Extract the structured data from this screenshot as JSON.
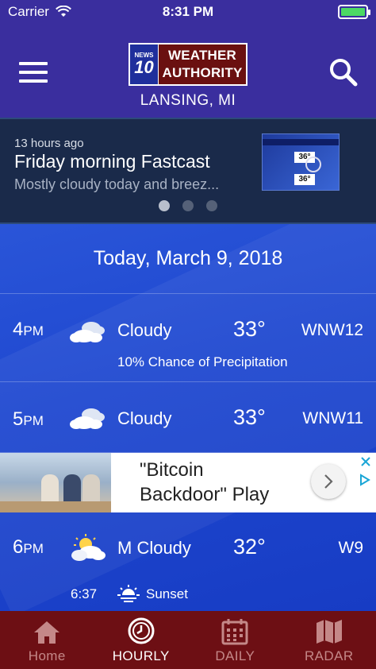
{
  "status_bar": {
    "carrier": "Carrier",
    "time": "8:31 PM"
  },
  "header": {
    "logo_badge_top": "NEWS",
    "logo_badge_number": "10",
    "logo_line1": "WEATHER",
    "logo_line2": "AUTHORITY",
    "location": "LANSING, MI"
  },
  "video": {
    "age": "13 hours ago",
    "title": "Friday morning Fastcast",
    "description": "Mostly cloudy today and breez...",
    "thumb_temp1": "36°",
    "thumb_temp2": "36°"
  },
  "forecast": {
    "date": "Today, March 9, 2018",
    "hours": [
      {
        "hour": "4",
        "ampm": "PM",
        "icon": "cloudy-icon",
        "condition": "Cloudy",
        "temp": "33°",
        "wind": "WNW12",
        "precip": "10% Chance of Precipitation"
      },
      {
        "hour": "5",
        "ampm": "PM",
        "icon": "cloudy-icon",
        "condition": "Cloudy",
        "temp": "33°",
        "wind": "WNW11"
      },
      {
        "hour": "6",
        "ampm": "PM",
        "icon": "mostly-cloudy-icon",
        "condition": "M Cloudy",
        "temp": "32°",
        "wind": "W9"
      }
    ],
    "sunset": {
      "time": "6:37",
      "label": "Sunset"
    }
  },
  "ad": {
    "line1": "\"Bitcoin",
    "line2": "Backdoor\" Play"
  },
  "tabs": [
    {
      "label": "Home",
      "icon": "home-icon",
      "active": false
    },
    {
      "label": "HOURLY",
      "icon": "clock-icon",
      "active": true
    },
    {
      "label": "DAILY",
      "icon": "calendar-icon",
      "active": false
    },
    {
      "label": "RADAR",
      "icon": "map-icon",
      "active": false
    }
  ],
  "colors": {
    "header_bg": "#3a2e9e",
    "forecast_bg": "#1f48d0",
    "tabbar_bg": "#6d0f14",
    "tab_active": "#ffffff",
    "tab_inactive": "#c48888",
    "battery": "#4cd964"
  }
}
